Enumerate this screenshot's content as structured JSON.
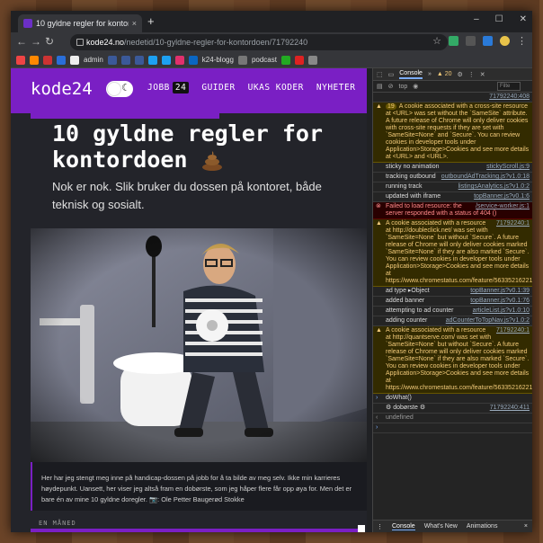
{
  "browser": {
    "tab_title": "10 gyldne regler for kontordoen",
    "tab_close": "×",
    "new_tab": "+",
    "url_domain": "kode24.no",
    "url_path": "/nedetid/10-gyldne-regler-for-kontordoen/71792240",
    "bookmarks": [
      "admin",
      "k24-blogg",
      "podcast"
    ],
    "win_min": "–",
    "win_max": "☐",
    "win_close": "✕",
    "icon_back": "←",
    "icon_forward": "→",
    "icon_reload": "↻",
    "icon_home": "⌂",
    "icon_star": "☆",
    "icon_menu": "⋮"
  },
  "site": {
    "logo": "kode24",
    "nav": {
      "jobb": "JOBB",
      "jobb_count": "24",
      "guider": "GUIDER",
      "ukas_koder": "UKAS KODER",
      "nyheter": "NYHETER"
    },
    "title": "10 gyldne regler for kontordoen",
    "lead": "Nok er nok. Slik bruker du dossen på kontoret, både teknisk og sosialt.",
    "caption": "Her har jeg stengt meg inne på handicap-dossen på jobb for å ta bilde av meg selv. Ikke min karrieres høydepunkt. Uansett, her viser jeg altså fram en dobørste, som jeg håper flere får opp øya for. Men det er bare én av mine 10 gyldne doregler.",
    "caption_credit": "📷: Ole Petter Baugerød Stokke",
    "month_label": "EN MÅNED"
  },
  "devtools": {
    "tabs": [
      "Console",
      "»"
    ],
    "warn_count": "▲ 20",
    "context": "top",
    "filter_placeholder": "Filte",
    "first_src": "71792240:408",
    "messages": [
      {
        "type": "warn",
        "text": "A cookie associated with a cross-site resource at <URL> was set without the `SameSite` attribute. A future release of Chrome will only deliver cookies with cross-site requests if they are set with `SameSite=None` and `Secure`. You can review cookies in developer tools under Application>Storage>Cookies and see more details at <URL> and <URL>.",
        "src": "",
        "count": "19"
      },
      {
        "type": "log",
        "text": "sticky no animation",
        "src": "stickyScroll.js:9"
      },
      {
        "type": "log",
        "text": "tracking outbound",
        "src": "outboundAdTracking.js?v1.0:18"
      },
      {
        "type": "log",
        "text": "running track",
        "src": "listingsAnalytics.js?v1.0:2"
      },
      {
        "type": "log",
        "text": "updated with iframe",
        "src": "topBanner.js?v0.1:6"
      },
      {
        "type": "err",
        "text": "Failed to load resource: the server responded with a status of 404 ()",
        "src": "/service-worker.js:1"
      },
      {
        "type": "warn",
        "text": "A cookie associated with a resource at http://doubleclick.net/ was set with `SameSite=None` but without `Secure`. A future release of Chrome will only deliver cookies marked `SameSite=None` if they are also marked `Secure`. You can review cookies in developer tools under Application>Storage>Cookies and see more details at https://www.chromestatus.com/feature/5633521622188032.",
        "src": "71792240:1"
      },
      {
        "type": "log",
        "text": "ad type ▸Object",
        "src": "topBanner.js?v0.1:39"
      },
      {
        "type": "log",
        "text": "added banner",
        "src": "topBanner.js?v0.1:76"
      },
      {
        "type": "log",
        "text": "attempting to ad counter",
        "src": "articleList.js?v1.0:10"
      },
      {
        "type": "log",
        "text": "adding counter",
        "src": "adCounterToTopNav.js?v1.0:2"
      },
      {
        "type": "warn",
        "text": "A cookie associated with a resource at http://quantserve.com/ was set with `SameSite=None` but without `Secure`. A future release of Chrome will only deliver cookies marked `SameSite=None` if they are also marked `Secure`. You can review cookies in developer tools under Application>Storage>Cookies and see more details at https://www.chromestatus.com/feature/5633521622188032.",
        "src": "71792240:1"
      }
    ],
    "input_cmd": "doWhat()",
    "output_text": "dobørste",
    "output_src": "71792240:411",
    "result": "undefined",
    "bottom_tabs": [
      "Console",
      "What's New",
      "Animations"
    ],
    "bottom_close": "×"
  },
  "colors": {
    "brand": "#7a1fc4",
    "warn_bg": "#332b00",
    "err_bg": "#290000"
  }
}
